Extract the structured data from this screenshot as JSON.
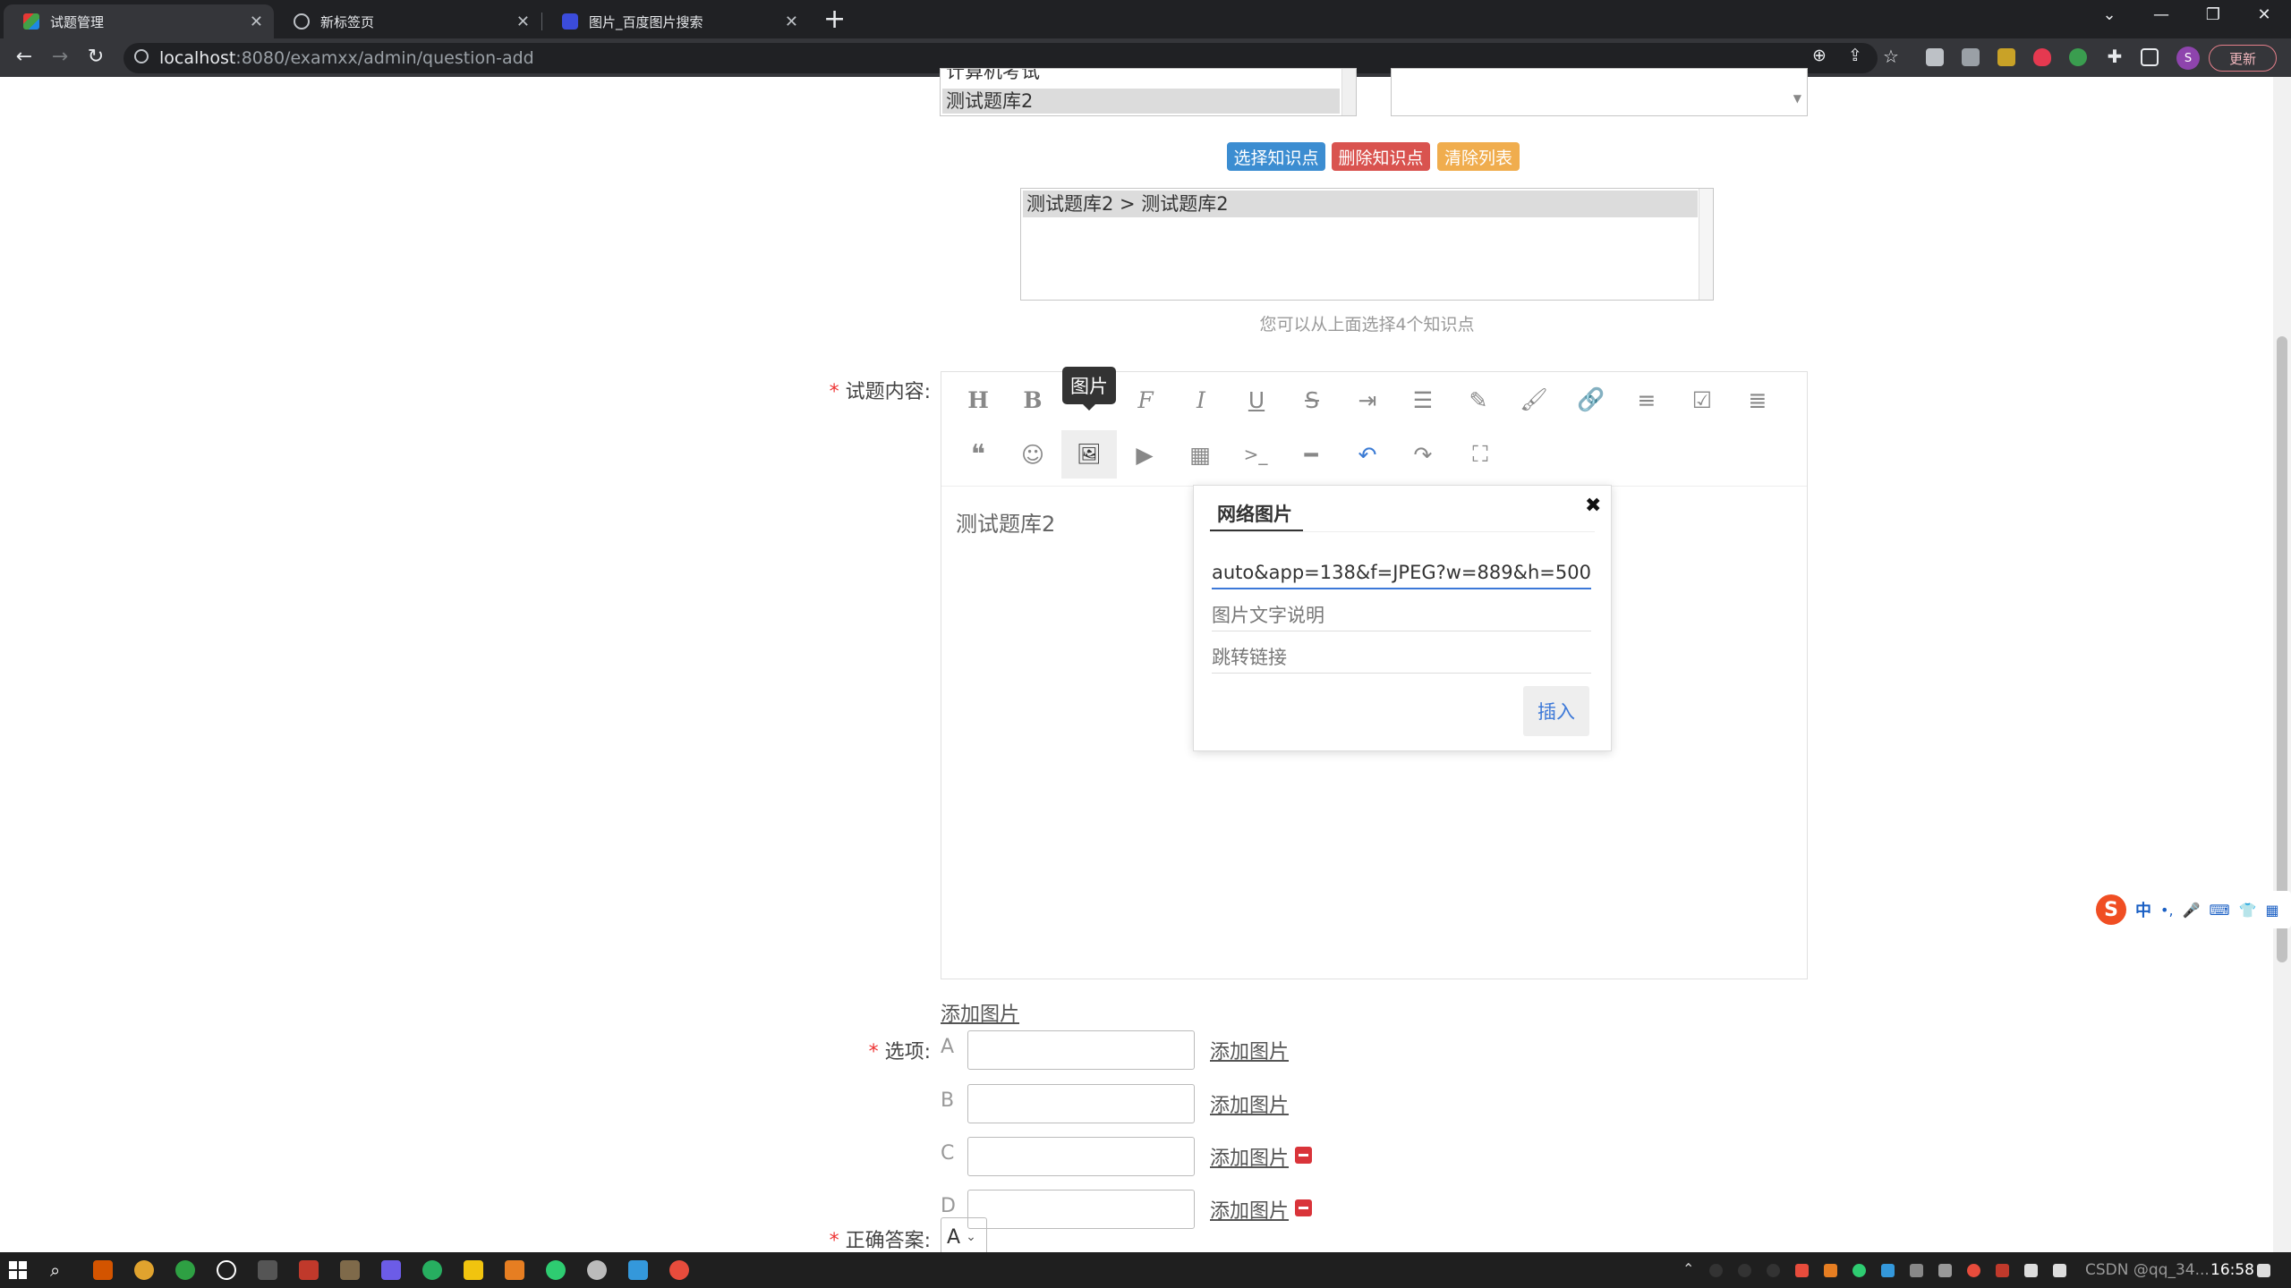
{
  "browser": {
    "tabs": [
      {
        "title": "试题管理",
        "active": true
      },
      {
        "title": "新标签页",
        "active": false
      },
      {
        "title": "图片_百度图片搜索",
        "active": false
      }
    ],
    "new_tab_icon": "plus-icon",
    "url_host": "localhost",
    "url_path": ":8080/examxx/admin/question-add",
    "update_button": "更新",
    "profile_initial": "S"
  },
  "form": {
    "top_listbox_items": [
      "计算机考试",
      "测试题库2"
    ],
    "knowledge_buttons": [
      {
        "label": "选择知识点",
        "color": "#3c8dd1"
      },
      {
        "label": "删除知识点",
        "color": "#d9534f"
      },
      {
        "label": "清除列表",
        "color": "#f0ad4e"
      }
    ],
    "selected_knowledge": [
      "测试题库2 > 测试题库2"
    ],
    "knowledge_hint": "您可以从上面选择4个知识点",
    "content_label": "试题内容:",
    "required_mark": "*",
    "editor": {
      "tooltip": "图片",
      "row1_icons": [
        "header-icon",
        "bold-icon",
        "italic-icon",
        "font-icon",
        "italic-icon",
        "underline-icon",
        "strikethrough-icon",
        "indent-icon",
        "line-height-icon",
        "pen-icon",
        "brush-icon",
        "link-icon",
        "list-icon",
        "checkbox-icon",
        "align-icon"
      ],
      "row2_icons": [
        "quote-icon",
        "emoji-icon",
        "image-icon",
        "video-icon",
        "table-icon",
        "code-icon",
        "hr-icon",
        "undo-icon",
        "redo-icon",
        "fullscreen-icon"
      ],
      "content_text": "测试题库2",
      "image_popup": {
        "tab_label": "网络图片",
        "url_value": "auto&app=138&f=JPEG?w=889&h=500",
        "alt_placeholder": "图片文字说明",
        "link_placeholder": "跳转链接",
        "insert_button": "插入"
      }
    },
    "add_image_link": "添加图片",
    "options_label": "选项:",
    "options": [
      {
        "letter": "A",
        "removable": false
      },
      {
        "letter": "B",
        "removable": false
      },
      {
        "letter": "C",
        "removable": true
      },
      {
        "letter": "D",
        "removable": true
      }
    ],
    "answer_label": "正确答案:",
    "answer_value": "A"
  },
  "ime": {
    "mode": "中",
    "punct": "•,"
  },
  "taskbar": {
    "time": "16:58",
    "watermark": "CSDN @qq_34..."
  }
}
